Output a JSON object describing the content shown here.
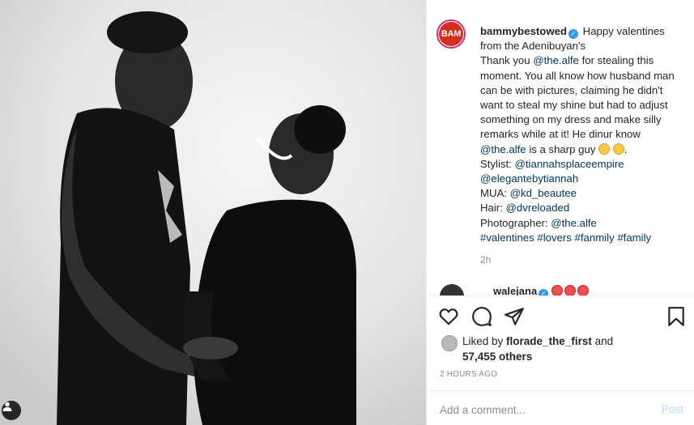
{
  "post": {
    "username": "bammybestowed",
    "avatar_text": "BAM",
    "caption_intro": "Happy valentines from the Adenibuyan's",
    "caption_thanks_pre": "Thank you ",
    "caption_mention_1": "@the.alfe",
    "caption_thanks_post": " for stealing this moment. You all know how husband man can be with pictures, claiming he didn't want to steal my shine but had to adjust something on my dress and make silly remarks while at it! He dinur know ",
    "caption_mention_2": "@the.alfe",
    "caption_sharp": " is a sharp guy ",
    "stylist_label": "Stylist: ",
    "stylist_handle_1": "@tiannahsplaceempire",
    "stylist_handle_2": "@elegantebytiannah",
    "mua_label": "MUA: ",
    "mua_handle": "@kd_beautee",
    "hair_label": "Hair: ",
    "hair_handle": "@dvreloaded",
    "photographer_label": "Photographer: ",
    "photographer_handle": "@the.alfe",
    "hashtags": "#valentines #lovers #fanmily #family",
    "age": "2h"
  },
  "comment": {
    "username": "walejana"
  },
  "likes": {
    "prefix": "Liked by ",
    "user": "florade_the_first",
    "connector": " and",
    "others": "57,455 others"
  },
  "timestamp": "2 HOURS AGO",
  "comment_box": {
    "placeholder": "Add a comment...",
    "post_label": "Post"
  },
  "icons": {
    "like": "heart-icon",
    "comment": "comment-icon",
    "share": "share-icon",
    "save": "bookmark-icon",
    "tags": "user-tag-icon",
    "verified": "verified-badge-icon"
  },
  "colors": {
    "link": "#00376b",
    "muted": "#8e8e8e",
    "verified": "#3897f0",
    "post_button": "#b3dbff",
    "avatar_brand": "#d62d20"
  }
}
